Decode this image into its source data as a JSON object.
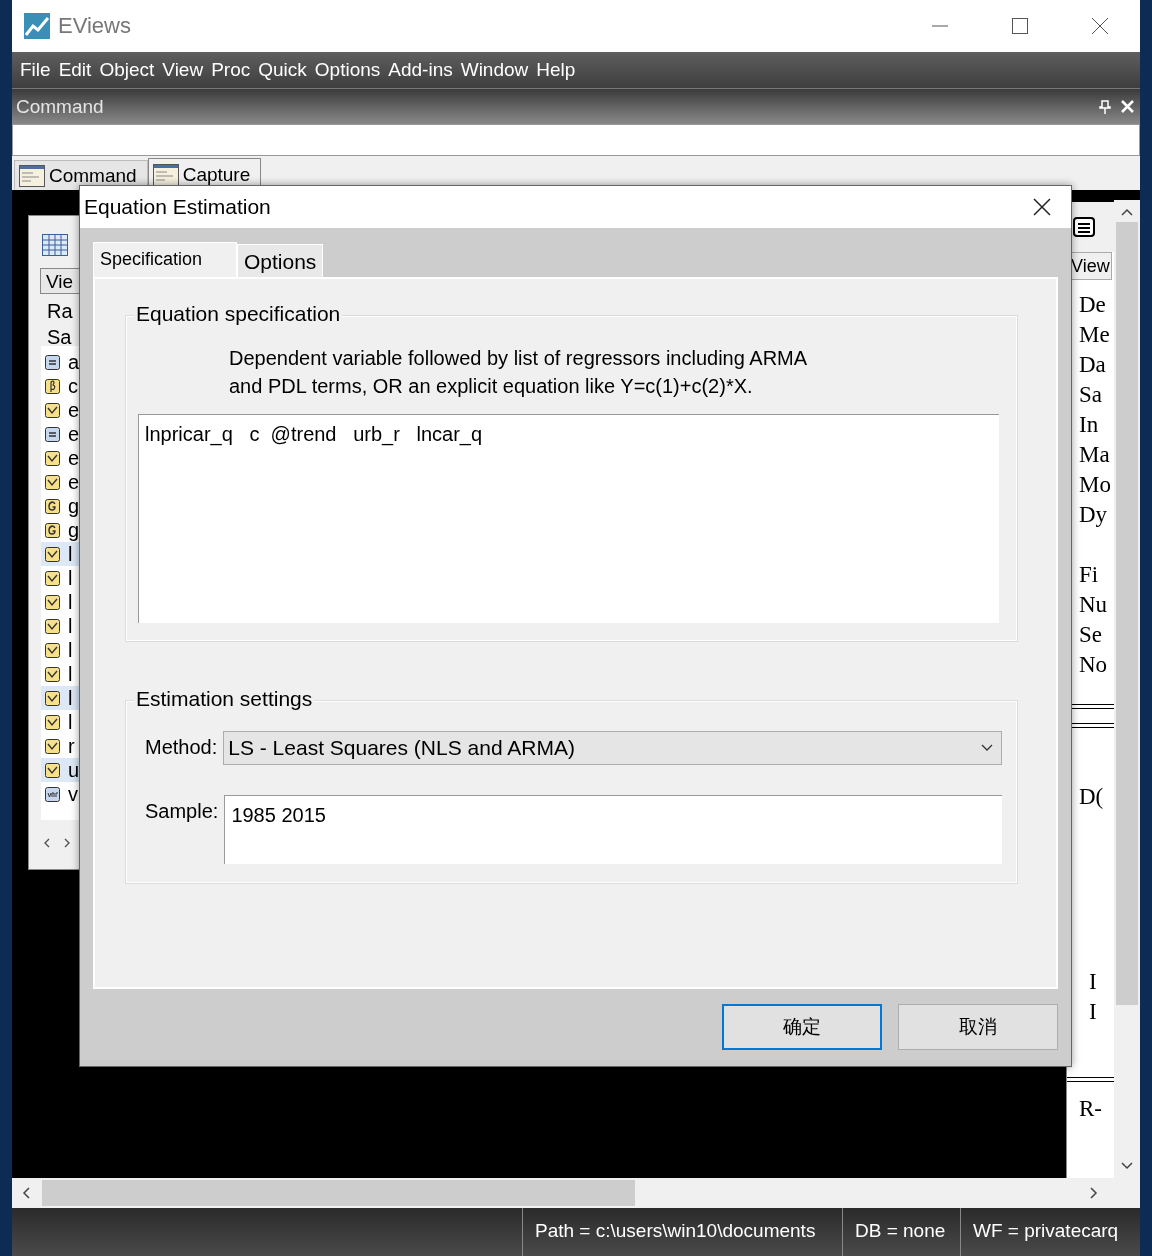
{
  "window": {
    "title": "EViews"
  },
  "menu": [
    "File",
    "Edit",
    "Object",
    "View",
    "Proc",
    "Quick",
    "Options",
    "Add-ins",
    "Window",
    "Help"
  ],
  "command_pane": {
    "title": "Command"
  },
  "command_tabs": [
    {
      "label": "Command",
      "selected": true
    },
    {
      "label": "Capture",
      "selected": false
    }
  ],
  "workfile_window": {
    "view_button": "Vie",
    "range_label": "Ra",
    "sample_label": "Sa",
    "objects": [
      {
        "name": "a",
        "kind": "equation",
        "selected": false
      },
      {
        "name": "c",
        "kind": "coef",
        "selected": false
      },
      {
        "name": "e",
        "kind": "series",
        "selected": false
      },
      {
        "name": "e",
        "kind": "equation",
        "selected": false
      },
      {
        "name": "e",
        "kind": "series",
        "selected": false
      },
      {
        "name": "e",
        "kind": "series",
        "selected": false
      },
      {
        "name": "g",
        "kind": "group",
        "selected": false
      },
      {
        "name": "g",
        "kind": "group",
        "selected": false
      },
      {
        "name": "l",
        "kind": "series",
        "selected": true
      },
      {
        "name": "l",
        "kind": "series",
        "selected": false
      },
      {
        "name": "l",
        "kind": "series",
        "selected": false
      },
      {
        "name": "l",
        "kind": "series",
        "selected": false
      },
      {
        "name": "l",
        "kind": "series",
        "selected": false
      },
      {
        "name": "l",
        "kind": "series",
        "selected": false
      },
      {
        "name": "l",
        "kind": "series",
        "selected": true
      },
      {
        "name": "l",
        "kind": "series",
        "selected": false
      },
      {
        "name": "r",
        "kind": "series",
        "selected": false
      },
      {
        "name": "u",
        "kind": "series",
        "selected": true
      },
      {
        "name": "v",
        "kind": "valmap",
        "selected": false
      }
    ]
  },
  "equation_window": {
    "view_button": "View",
    "blocks": [
      [
        "De",
        "Me",
        "Da",
        "Sa",
        "In",
        "Ma",
        "Mo",
        "Dy"
      ],
      [
        "Fi",
        "Nu",
        "Se",
        "No"
      ],
      [
        "D("
      ],
      [
        "I",
        "I"
      ],
      [
        "R-"
      ]
    ]
  },
  "dialog": {
    "title": "Equation Estimation",
    "tabs": [
      {
        "label": "Specification",
        "selected": true
      },
      {
        "label": "Options",
        "selected": false
      }
    ],
    "specification": {
      "legend": "Equation specification",
      "hint": "Dependent variable followed by list of regressors including ARMA\nand PDL terms, OR an explicit equation like Y=c(1)+c(2)*X.",
      "value": "lnpricar_q   c  @trend   urb_r   lncar_q"
    },
    "settings": {
      "legend": "Estimation settings",
      "method_label": "Method:",
      "method_value": "LS  -  Least Squares (NLS and ARMA)",
      "sample_label": "Sample:",
      "sample_value": "1985 2015"
    },
    "buttons": [
      {
        "label": "确定",
        "default": true
      },
      {
        "label": "取消",
        "default": false
      }
    ]
  },
  "status_bar": [
    "Path = c:\\users\\win10\\documents",
    "DB = none",
    "WF = privatecarq"
  ]
}
